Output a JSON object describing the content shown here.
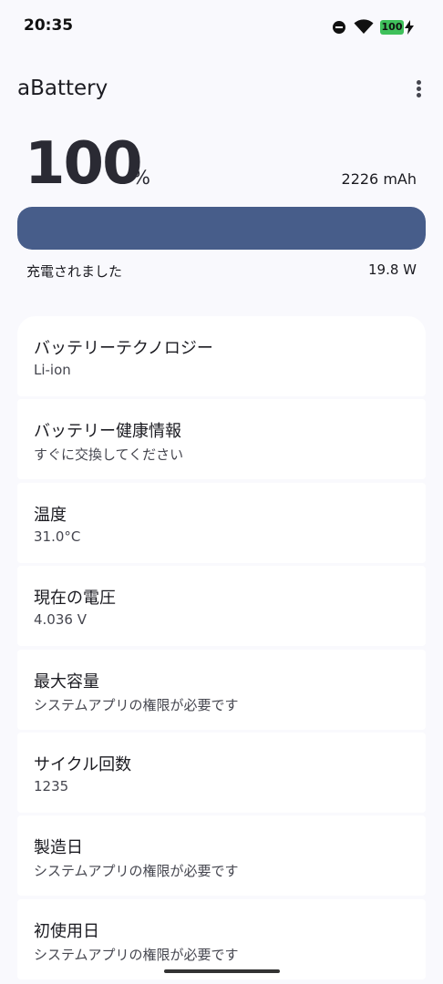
{
  "status_bar": {
    "time": "20:35",
    "battery_level": "100",
    "icons": [
      "do-not-disturb-icon",
      "wifi-icon",
      "battery-icon",
      "charging-bolt-icon"
    ]
  },
  "app_bar": {
    "title": "aBattery",
    "menu_icon": "overflow-menu-icon"
  },
  "battery": {
    "percent": "100",
    "percent_sign": "%",
    "capacity": "2226 mAh",
    "level_fraction": 1.0,
    "status": "充電されました",
    "power": "19.8 W"
  },
  "info_items": [
    {
      "title": "バッテリーテクノロジー",
      "value": "Li-ion"
    },
    {
      "title": "バッテリー健康情報",
      "value": "すぐに交換してください"
    },
    {
      "title": "温度",
      "value": "31.0°C"
    },
    {
      "title": "現在の電圧",
      "value": "4.036 V"
    },
    {
      "title": "最大容量",
      "value": "システムアプリの権限が必要です"
    },
    {
      "title": "サイクル回数",
      "value": "1235"
    },
    {
      "title": "製造日",
      "value": "システムアプリの権限が必要です"
    },
    {
      "title": "初使用日",
      "value": "システムアプリの権限が必要です"
    }
  ],
  "colors": {
    "background": "#f9f9fd",
    "bar_fill": "#475d8a",
    "battery_badge": "#3fc15b",
    "card": "#ffffff"
  }
}
